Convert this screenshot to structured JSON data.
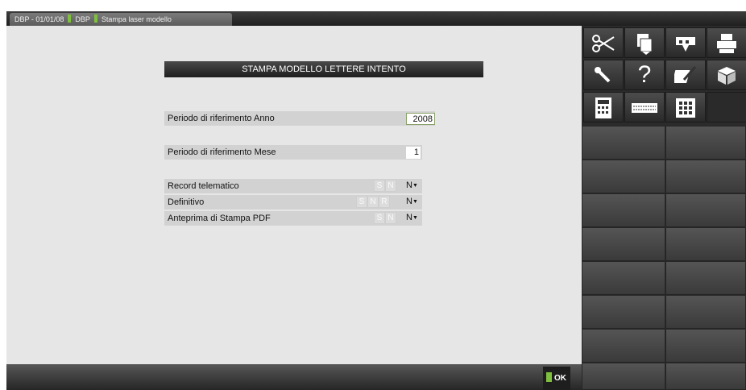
{
  "tab": {
    "segment1": "DBP - 01/01/08",
    "segment2": "DBP",
    "segment3": "Stampa laser modello"
  },
  "form": {
    "title": "STAMPA MODELLO LETTERE INTENTO",
    "anno": {
      "label": "Periodo di riferimento Anno",
      "value": "2008"
    },
    "mese": {
      "label": "Periodo di riferimento Mese",
      "value": "1"
    },
    "record": {
      "label": "Record telematico",
      "options": [
        "S",
        "N"
      ],
      "value": "N"
    },
    "definitivo": {
      "label": "Definitivo",
      "options": [
        "S",
        "N",
        "R"
      ],
      "value": "N"
    },
    "anteprima": {
      "label": "Anteprima di Stampa PDF",
      "options": [
        "S",
        "N"
      ],
      "value": "N"
    }
  },
  "footer": {
    "ok_label": "OK"
  },
  "toolbar": {
    "icons": [
      "scissors-icon",
      "copy-icon",
      "paste-icon",
      "print-icon",
      "wrench-icon",
      "help-icon",
      "edit-icon",
      "cube-icon",
      "calculator-icon",
      "keyboard-icon",
      "grid-icon"
    ]
  },
  "colors": {
    "accent_green": "#7fbf3f",
    "panel_dark": "#2b2b2b",
    "form_bg": "#e6e6e6"
  }
}
